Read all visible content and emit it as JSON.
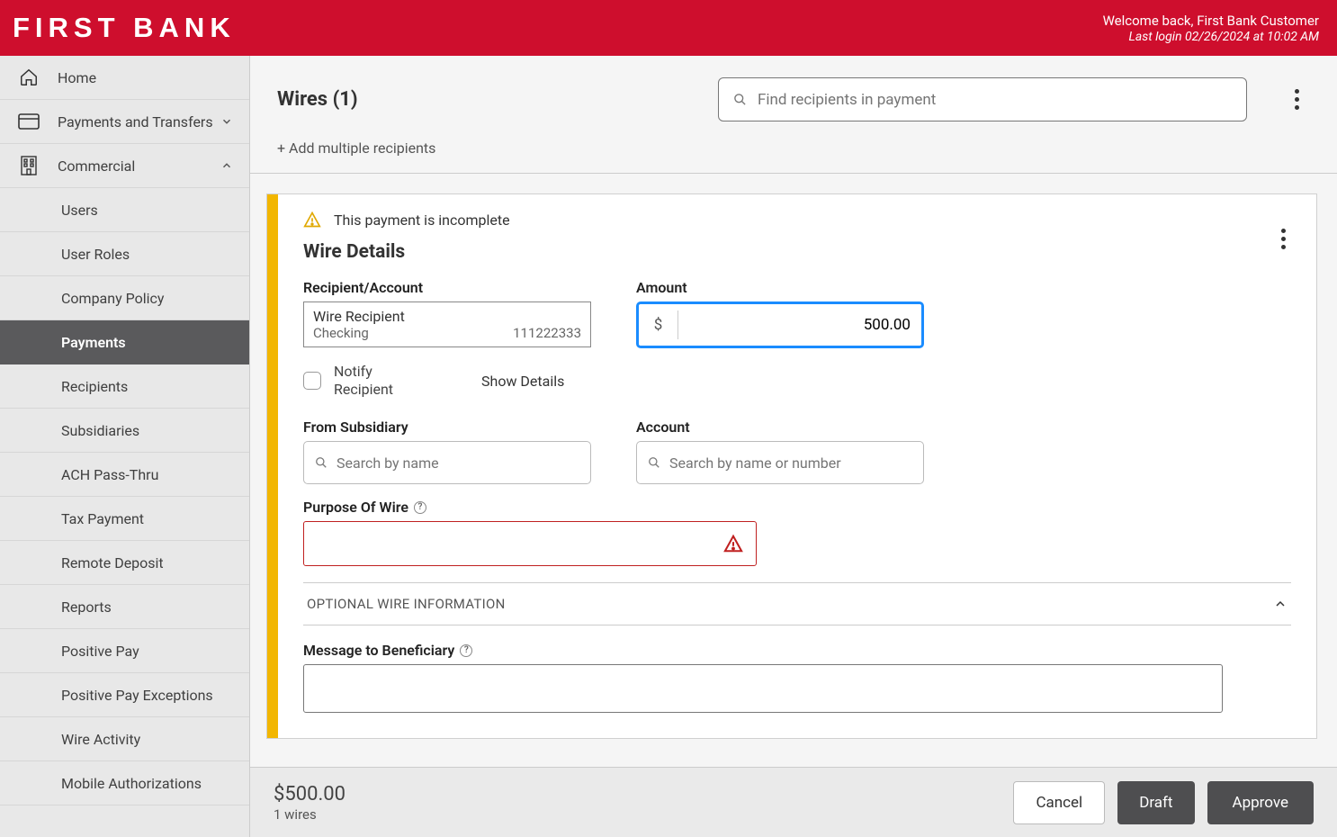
{
  "header": {
    "logo": "FIRST BANK",
    "welcome": "Welcome back, First Bank Customer",
    "last_login": "Last login 02/26/2024 at 10:02 AM"
  },
  "sidebar": {
    "home": "Home",
    "payments_transfers": "Payments and Transfers",
    "commercial": "Commercial",
    "items": [
      "Users",
      "User Roles",
      "Company Policy",
      "Payments",
      "Recipients",
      "Subsidiaries",
      "ACH Pass-Thru",
      "Tax Payment",
      "Remote Deposit",
      "Reports",
      "Positive Pay",
      "Positive Pay Exceptions",
      "Wire Activity",
      "Mobile Authorizations"
    ],
    "active_index": 3
  },
  "page": {
    "title": "Wires (1)",
    "search_placeholder": "Find recipients in payment",
    "add_multiple": "+ Add multiple recipients"
  },
  "card": {
    "warning": "This payment is incomplete",
    "section_title": "Wire Details",
    "labels": {
      "recipient_account": "Recipient/Account",
      "amount": "Amount",
      "notify": "Notify Recipient",
      "show_details": "Show Details",
      "from_subsidiary": "From Subsidiary",
      "account": "Account",
      "purpose": "Purpose Of Wire",
      "optional_header": "OPTIONAL WIRE INFORMATION",
      "message": "Message to Beneficiary"
    },
    "recipient": {
      "name": "Wire Recipient",
      "type": "Checking",
      "number": "111222333"
    },
    "amount": {
      "currency": "$",
      "value": "500.00"
    },
    "placeholders": {
      "subsidiary": "Search by name",
      "account": "Search by name or number"
    }
  },
  "footer": {
    "total": "$500.00",
    "count": "1 wires",
    "cancel": "Cancel",
    "draft": "Draft",
    "approve": "Approve"
  }
}
